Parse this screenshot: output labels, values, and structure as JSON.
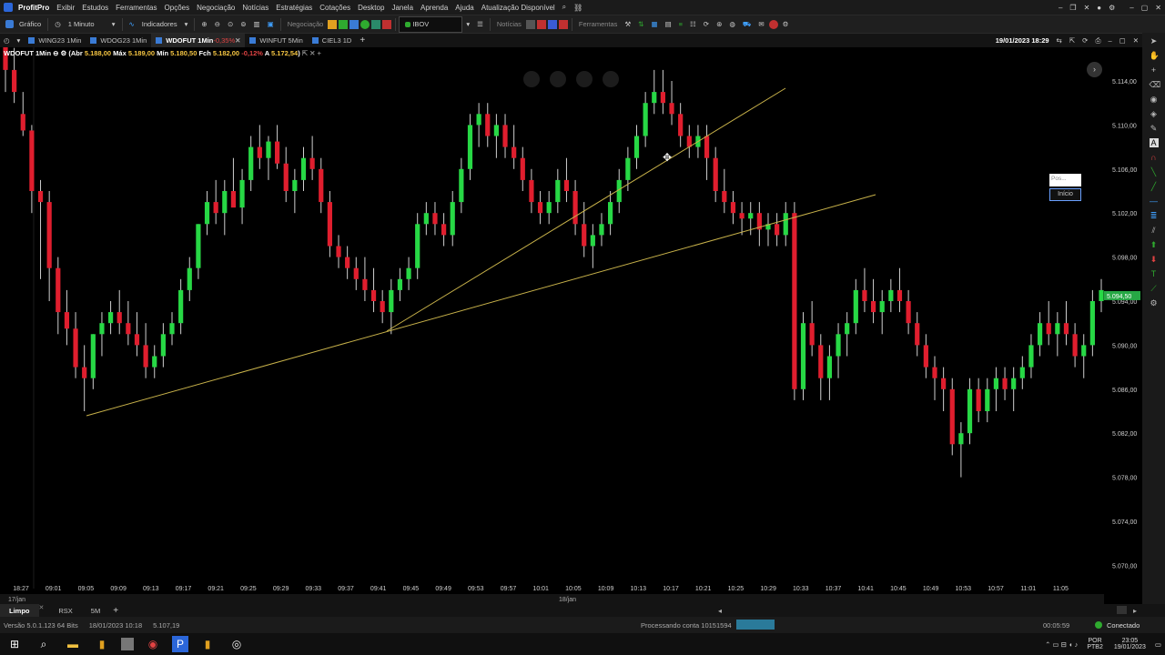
{
  "app": {
    "title": "ProfitPro"
  },
  "menu": [
    "Exibir",
    "Estudos",
    "Ferramentas",
    "Opções",
    "Negociação",
    "Notícias",
    "Estratégias",
    "Cotações",
    "Desktop",
    "Janela",
    "Aprenda",
    "Ajuda",
    "Atualização Disponível"
  ],
  "toolbar": {
    "chart_label": "Gráfico",
    "timeframe": "1 Minuto",
    "indicators_label": "Indicadores",
    "negociacao_label": "Negociação",
    "symbol_value": "IBOV",
    "noticias_label": "Notícias",
    "ferramentas_label": "Ferramentas"
  },
  "tabs": [
    {
      "label": "WING23 1Min",
      "active": false
    },
    {
      "label": "WDOG23 1Min",
      "active": false
    },
    {
      "label": "WDOFUT 1Min",
      "change": "-0,35%",
      "active": true
    },
    {
      "label": "WINFUT 5Min",
      "active": false
    },
    {
      "label": "CIEL3 1D",
      "active": false
    }
  ],
  "datetime": "19/01/2023 18:29",
  "legend": {
    "symbol": "WDOFUT 1Min",
    "abr_label": "Abr",
    "abr": "5.188,00",
    "max_label": "Máx",
    "max": "5.189,00",
    "min_label": "Mín",
    "min": "5.180,50",
    "fch_label": "Fch",
    "fch": "5.182,00",
    "chg": "-0,12%",
    "a_label": "A",
    "a": "5.172,54"
  },
  "price_axis": [
    "5.114,00",
    "5.110,00",
    "5.106,00",
    "5.102,00",
    "5.098,00",
    "5.094,00",
    "5.090,00",
    "5.086,00",
    "5.082,00",
    "5.078,00",
    "5.074,00",
    "5.070,00"
  ],
  "current_price": "5.094,50",
  "time_axis": [
    "18:27",
    "09:01",
    "09:05",
    "09:09",
    "09:13",
    "09:17",
    "09:21",
    "09:25",
    "09:29",
    "09:33",
    "09:37",
    "09:41",
    "09:45",
    "09:49",
    "09:53",
    "09:57",
    "10:01",
    "10:05",
    "10:09",
    "10:13",
    "10:17",
    "10:21",
    "10:25",
    "10:29",
    "10:33",
    "10:37",
    "10:41",
    "10:45",
    "10:49",
    "10:53",
    "10:57",
    "11:01",
    "11:05"
  ],
  "date_left": "17/jan",
  "date_mid": "18/jan",
  "popup": {
    "line1": "Pos...",
    "line2": "Início"
  },
  "bottom_tabs": [
    "Limpo",
    "RSX",
    "5M"
  ],
  "status": {
    "version": "Versão 5.0.1.123 64 Bits",
    "date": "18/01/2023 10:18",
    "price": "5.107,19",
    "processing": "Processando conta 10151594",
    "timer": "00:05:59",
    "connection": "Conectado"
  },
  "taskbar": {
    "lang": "POR",
    "layout": "PTB2",
    "time": "23:05",
    "date": "19/01/2023"
  },
  "colors": {
    "up": "#27d845",
    "down": "#e01e2e",
    "trend": "#c8b24a",
    "background": "#000000"
  },
  "candles": [
    [
      5118,
      5118.5,
      5113,
      5115
    ],
    [
      5115,
      5117,
      5112,
      5113
    ],
    [
      5111,
      5113,
      5109,
      5109.5
    ],
    [
      5109.5,
      5110,
      5102,
      5104
    ],
    [
      5104,
      5105,
      5096,
      5103
    ],
    [
      5103,
      5104,
      5094,
      5097
    ],
    [
      5097,
      5098,
      5091,
      5093
    ],
    [
      5093,
      5095,
      5090,
      5091.5
    ],
    [
      5091.5,
      5093,
      5087,
      5088
    ],
    [
      5088,
      5090,
      5084,
      5087
    ],
    [
      5087,
      5091,
      5086,
      5091
    ],
    [
      5091,
      5093,
      5089,
      5092
    ],
    [
      5092,
      5094,
      5091,
      5093
    ],
    [
      5093,
      5095,
      5091,
      5092
    ],
    [
      5092,
      5094,
      5090,
      5091
    ],
    [
      5091,
      5093,
      5089,
      5090
    ],
    [
      5090,
      5092,
      5087,
      5088
    ],
    [
      5088,
      5090,
      5087,
      5089
    ],
    [
      5089,
      5092,
      5088,
      5091
    ],
    [
      5091,
      5093,
      5090,
      5092
    ],
    [
      5092,
      5096,
      5091,
      5095
    ],
    [
      5095,
      5098,
      5094,
      5097
    ],
    [
      5097,
      5101,
      5096,
      5101
    ],
    [
      5101,
      5104,
      5100,
      5103
    ],
    [
      5103,
      5105,
      5101,
      5102
    ],
    [
      5102,
      5105,
      5100,
      5104
    ],
    [
      5104,
      5107,
      5103,
      5102.5
    ],
    [
      5102.5,
      5106,
      5101,
      5105
    ],
    [
      5105,
      5109,
      5104,
      5108
    ],
    [
      5108,
      5110,
      5106,
      5107
    ],
    [
      5107,
      5109,
      5105,
      5108.5
    ],
    [
      5108.5,
      5110,
      5106,
      5106.5
    ],
    [
      5106.5,
      5108,
      5103,
      5104
    ],
    [
      5104,
      5106,
      5102,
      5105
    ],
    [
      5105,
      5108,
      5104,
      5107
    ],
    [
      5107,
      5109,
      5105,
      5106
    ],
    [
      5106,
      5107,
      5102,
      5103
    ],
    [
      5103,
      5104,
      5098,
      5099
    ],
    [
      5099,
      5100,
      5097,
      5098
    ],
    [
      5098,
      5099,
      5096,
      5097
    ],
    [
      5097,
      5098,
      5095,
      5096
    ],
    [
      5096,
      5098,
      5094,
      5095
    ],
    [
      5095,
      5097,
      5093,
      5094
    ],
    [
      5094,
      5095,
      5092,
      5093
    ],
    [
      5093,
      5096,
      5091,
      5095
    ],
    [
      5095,
      5097,
      5094,
      5096
    ],
    [
      5096,
      5098,
      5095,
      5097
    ],
    [
      5097,
      5102,
      5096,
      5101
    ],
    [
      5101,
      5103,
      5100,
      5102
    ],
    [
      5102,
      5103,
      5100,
      5101
    ],
    [
      5101,
      5102,
      5099,
      5100
    ],
    [
      5100,
      5104,
      5099,
      5103
    ],
    [
      5103,
      5107,
      5102,
      5106
    ],
    [
      5106,
      5111,
      5105,
      5110
    ],
    [
      5110,
      5112,
      5108,
      5111
    ],
    [
      5111,
      5112,
      5108,
      5109
    ],
    [
      5109,
      5111,
      5107,
      5110
    ],
    [
      5110,
      5111,
      5107,
      5108
    ],
    [
      5108,
      5110,
      5106,
      5107
    ],
    [
      5107,
      5108,
      5104,
      5105
    ],
    [
      5105,
      5106,
      5102,
      5103
    ],
    [
      5103,
      5104,
      5101,
      5102
    ],
    [
      5102,
      5104,
      5101,
      5103
    ],
    [
      5103,
      5106,
      5102,
      5105
    ],
    [
      5105,
      5107,
      5103,
      5104
    ],
    [
      5104,
      5105,
      5100,
      5101
    ],
    [
      5101,
      5103,
      5098,
      5099
    ],
    [
      5099,
      5101,
      5097,
      5100
    ],
    [
      5100,
      5102,
      5099,
      5101
    ],
    [
      5101,
      5104,
      5100,
      5103
    ],
    [
      5103,
      5106,
      5102,
      5105
    ],
    [
      5105,
      5108,
      5104,
      5107
    ],
    [
      5107,
      5110,
      5106,
      5109
    ],
    [
      5109,
      5113,
      5108,
      5112
    ],
    [
      5112,
      5115,
      5111,
      5113
    ],
    [
      5113,
      5115,
      5111,
      5112
    ],
    [
      5112,
      5114,
      5110,
      5111
    ],
    [
      5111,
      5112,
      5108,
      5109
    ],
    [
      5109,
      5110,
      5107,
      5108
    ],
    [
      5108,
      5110,
      5107,
      5109
    ],
    [
      5109,
      5110,
      5105,
      5107
    ],
    [
      5107,
      5108,
      5103,
      5104
    ],
    [
      5104,
      5106,
      5102,
      5103
    ],
    [
      5103,
      5104,
      5101,
      5102
    ],
    [
      5102,
      5103,
      5100,
      5101.5
    ],
    [
      5101.5,
      5103,
      5100,
      5102
    ],
    [
      5102,
      5103,
      5099,
      5100.5
    ],
    [
      5100.5,
      5102,
      5099,
      5101
    ],
    [
      5101,
      5102,
      5099,
      5100
    ],
    [
      5100,
      5103,
      5099,
      5102
    ],
    [
      5102,
      5103,
      5085,
      5086
    ],
    [
      5086,
      5093,
      5085,
      5092
    ],
    [
      5092,
      5094,
      5089,
      5090
    ],
    [
      5090,
      5091,
      5085,
      5087
    ],
    [
      5087,
      5090,
      5085,
      5089
    ],
    [
      5089,
      5092,
      5087,
      5091
    ],
    [
      5091,
      5093,
      5089,
      5092
    ],
    [
      5092,
      5096,
      5091,
      5095
    ],
    [
      5095,
      5097,
      5093,
      5094
    ],
    [
      5094,
      5096,
      5092,
      5093
    ],
    [
      5093,
      5095,
      5091,
      5094
    ],
    [
      5094,
      5096,
      5093,
      5095
    ],
    [
      5095,
      5097,
      5093,
      5094
    ],
    [
      5094,
      5095,
      5091,
      5092
    ],
    [
      5092,
      5093,
      5089,
      5090
    ],
    [
      5090,
      5091,
      5087,
      5088
    ],
    [
      5088,
      5089,
      5085,
      5087
    ],
    [
      5087,
      5088,
      5084,
      5086
    ],
    [
      5086,
      5087,
      5080,
      5081
    ],
    [
      5081,
      5083,
      5078,
      5082
    ],
    [
      5082,
      5087,
      5081,
      5086
    ],
    [
      5086,
      5087,
      5083,
      5084
    ],
    [
      5084,
      5087,
      5083,
      5086
    ],
    [
      5086,
      5088,
      5084,
      5087
    ],
    [
      5087,
      5088,
      5085,
      5086
    ],
    [
      5086,
      5088,
      5084,
      5087
    ],
    [
      5087,
      5089,
      5086,
      5088
    ],
    [
      5088,
      5091,
      5087,
      5090
    ],
    [
      5090,
      5093,
      5089,
      5092
    ],
    [
      5092,
      5094,
      5090,
      5091
    ],
    [
      5091,
      5093,
      5089,
      5092
    ],
    [
      5092,
      5094,
      5090,
      5091
    ],
    [
      5091,
      5092,
      5088,
      5089
    ],
    [
      5089,
      5091,
      5087,
      5090
    ],
    [
      5090,
      5095,
      5089,
      5094
    ],
    [
      5094,
      5096,
      5093,
      5095
    ]
  ]
}
